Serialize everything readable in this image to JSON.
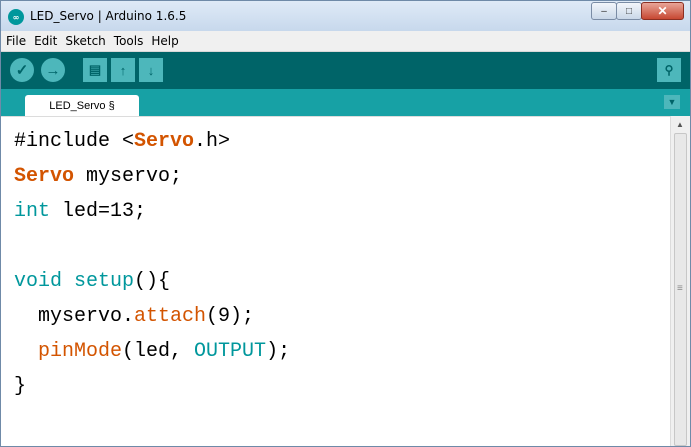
{
  "window": {
    "title": "LED_Servo | Arduino 1.6.5",
    "app_icon_glyph": "∞"
  },
  "window_controls": {
    "minimize": "–",
    "maximize": "□",
    "close": "✕"
  },
  "menu": [
    "File",
    "Edit",
    "Sketch",
    "Tools",
    "Help"
  ],
  "toolbar": {
    "verify_icon": "✓",
    "upload_icon": "→",
    "new_icon": "▤",
    "open_icon": "↑",
    "save_icon": "↓",
    "serial_monitor_icon": "⚲"
  },
  "tabs": {
    "active": "LED_Servo §",
    "menu_icon": "▼"
  },
  "code": [
    [
      {
        "t": "#include <"
      },
      {
        "t": "Servo",
        "c": "tok-bold"
      },
      {
        "t": ".h>"
      }
    ],
    [
      {
        "t": "Servo",
        "c": "tok-bold"
      },
      {
        "t": " myservo;"
      }
    ],
    [
      {
        "t": "int",
        "c": "tok-kw"
      },
      {
        "t": " led=13;"
      }
    ],
    [],
    [
      {
        "t": "void",
        "c": "tok-kw"
      },
      {
        "t": " "
      },
      {
        "t": "setup",
        "c": "tok-kw"
      },
      {
        "t": "(){"
      }
    ],
    [
      {
        "t": "  myservo."
      },
      {
        "t": "attach",
        "c": "tok-type"
      },
      {
        "t": "(9);"
      }
    ],
    [
      {
        "t": "  "
      },
      {
        "t": "pinMode",
        "c": "tok-type"
      },
      {
        "t": "(led, "
      },
      {
        "t": "OUTPUT",
        "c": "tok-kw"
      },
      {
        "t": ");"
      }
    ],
    [
      {
        "t": "}"
      }
    ]
  ],
  "colors": {
    "toolbar": "#006468",
    "tabbar": "#17a1a5",
    "keyword": "#00979c",
    "type": "#d35400"
  }
}
